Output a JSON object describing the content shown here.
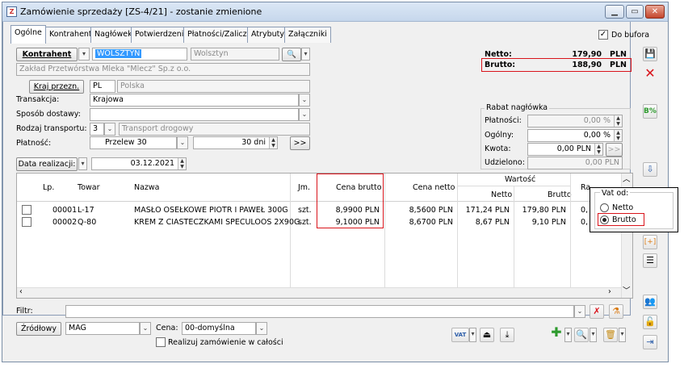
{
  "window": {
    "title": "Zamówienie sprzedaży [ZS-4/21] - zostanie zmienione",
    "app_icon": "Z"
  },
  "tabs": [
    {
      "label": "Ogólne"
    },
    {
      "label": "Kontrahent"
    },
    {
      "label": "Nagłówek"
    },
    {
      "label": "Potwierdzenie"
    },
    {
      "label": "Płatności/Zaliczki"
    },
    {
      "label": "Atrybuty"
    },
    {
      "label": "Załączniki"
    }
  ],
  "do_bufora": {
    "label": "Do bufora",
    "checked": "✓"
  },
  "kontrahent": {
    "button": "Kontrahent",
    "code": "WOLSZTYN",
    "city": "Wolsztyn",
    "name": "Zakład Przetwórstwa Mleka \"Mlecz\" Sp.z o.o.",
    "kraj_button": "Kraj przezn.",
    "kraj_code": "PL",
    "kraj_name": "Polska"
  },
  "totals": {
    "netto_label": "Netto:",
    "netto_value": "179,90",
    "netto_cur": "PLN",
    "brutto_label": "Brutto:",
    "brutto_value": "188,90",
    "brutto_cur": "PLN"
  },
  "form": {
    "transakcja_label": "Transakcja:",
    "transakcja_value": "Krajowa",
    "sposob_label": "Sposób dostawy:",
    "sposob_value": "",
    "rodzaj_label": "Rodzaj transportu:",
    "rodzaj_num": "3",
    "rodzaj_value": "Transport drogowy",
    "platnosc_label": "Płatność:",
    "platnosc_value": "Przelew 30",
    "platnosc_days": "30 dni",
    "platnosc_more": ">>",
    "data_button": "Data realizacji:",
    "data_value": "03.12.2021"
  },
  "rabat": {
    "group_label": "Rabat nagłówka",
    "platnosci_label": "Płatności:",
    "platnosci_value": "0,00 %",
    "ogolny_label": "Ogólny:",
    "ogolny_value": "0,00 %",
    "kwota_label": "Kwota:",
    "kwota_value": "0,00 PLN",
    "kwota_more": ">>",
    "udzielono_label": "Udzielono:",
    "udzielono_value": "0,00 PLN"
  },
  "grid": {
    "headers": {
      "lp": "Lp.",
      "towar": "Towar",
      "nazwa": "Nazwa",
      "jm": "Jm.",
      "cena_brutto": "Cena brutto",
      "cena_netto": "Cena netto",
      "wartosc": "Wartość",
      "netto": "Netto",
      "brutto": "Brutto",
      "rabat": "Ra"
    },
    "rows": [
      {
        "lp": "00001",
        "towar": "L-17",
        "nazwa": "MASŁO OSEŁKOWE PIOTR I PAWEŁ 300G",
        "jm": "szt.",
        "cena_brutto": "8,9900 PLN",
        "cena_netto": "8,5600 PLN",
        "netto": "171,24 PLN",
        "brutto": "179,80 PLN",
        "rabat": "0,"
      },
      {
        "lp": "00002",
        "towar": "Q-80",
        "nazwa": "KREM Z CIASTECZKAMI SPECULOOS 2X90G",
        "jm": "szt.",
        "cena_brutto": "9,1000 PLN",
        "cena_netto": "8,6700 PLN",
        "netto": "8,67 PLN",
        "brutto": "9,10 PLN",
        "rabat": "0,"
      }
    ]
  },
  "filter": {
    "label": "Filtr:",
    "value": ""
  },
  "bottom": {
    "zrodlowy_button": "Źródłowy",
    "magazyn": "MAG",
    "cena_label": "Cena:",
    "cena_value": "00-domyślna",
    "realizuj_label": "Realizuj zamówienie w całości"
  },
  "popup": {
    "title": "Vat od:",
    "netto": "Netto",
    "brutto": "Brutto"
  },
  "colors": {
    "highlight_red": "#d9141b",
    "selection_blue": "#3399ff",
    "title_gradient": "#c6d7ec"
  }
}
